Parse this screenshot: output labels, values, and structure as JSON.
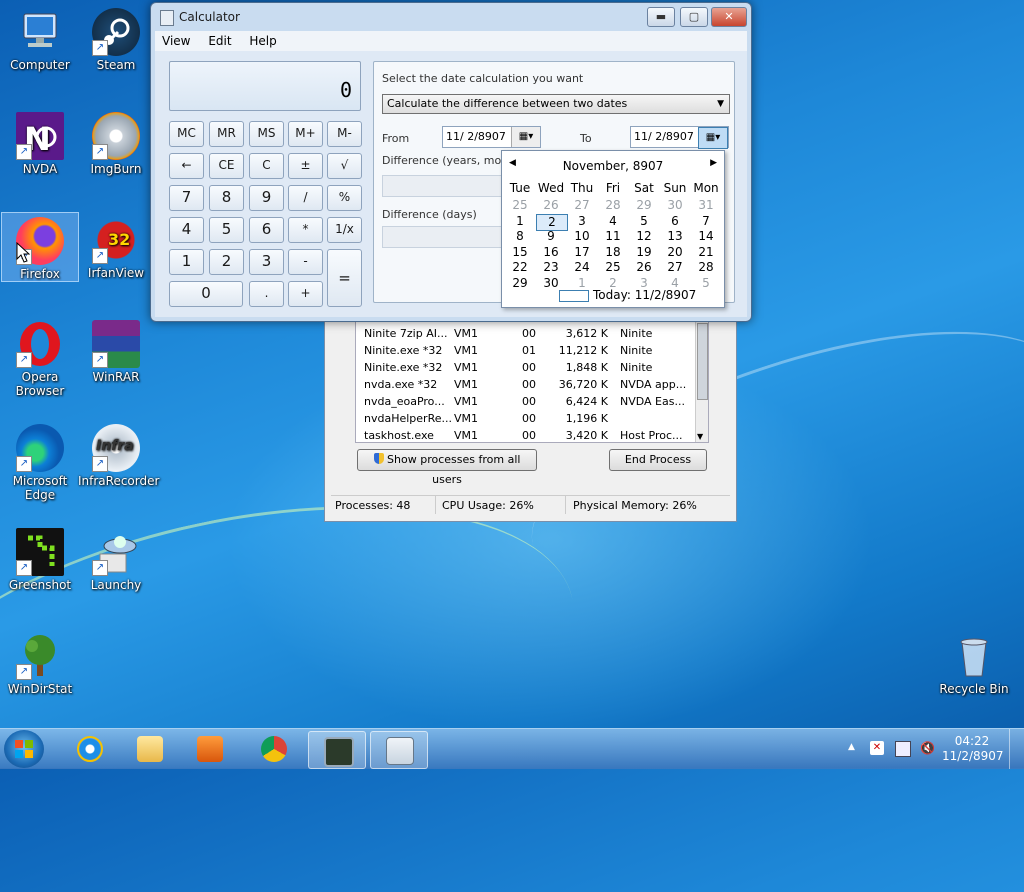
{
  "desktop": {
    "icons": [
      {
        "label": "Computer",
        "icon": "computer-icon"
      },
      {
        "label": "Steam",
        "icon": "steam-icon"
      },
      {
        "label": "NVDA",
        "icon": "nvda-icon"
      },
      {
        "label": "ImgBurn",
        "icon": "imgburn-icon"
      },
      {
        "label": "Firefox",
        "icon": "firefox-icon"
      },
      {
        "label": "IrfanView",
        "icon": "irfanview-icon"
      },
      {
        "label": "Opera Browser",
        "icon": "opera-icon"
      },
      {
        "label": "WinRAR",
        "icon": "winrar-icon"
      },
      {
        "label": "Microsoft Edge",
        "icon": "edge-icon"
      },
      {
        "label": "InfraRecorder",
        "icon": "infrarecorder-icon"
      },
      {
        "label": "Greenshot",
        "icon": "greenshot-icon"
      },
      {
        "label": "Launchy",
        "icon": "launchy-icon"
      },
      {
        "label": "WinDirStat",
        "icon": "windirstat-icon"
      },
      {
        "label": "Recycle Bin",
        "icon": "recycle-bin-icon"
      }
    ],
    "irfanview_badge": "32",
    "infrarecorder_overlay": "Infra"
  },
  "calculator": {
    "title": "Calculator",
    "menu": [
      "View",
      "Edit",
      "Help"
    ],
    "display": "0",
    "buttons": {
      "mem": [
        "MC",
        "MR",
        "MS",
        "M+",
        "M-"
      ],
      "row2": [
        "←",
        "CE",
        "C",
        "±",
        "√"
      ],
      "row3": [
        "7",
        "8",
        "9",
        "/",
        "%"
      ],
      "row4": [
        "4",
        "5",
        "6",
        "*",
        "1/x"
      ],
      "row5": [
        "1",
        "2",
        "3",
        "-"
      ],
      "row6": [
        "0",
        ".",
        "+"
      ],
      "equals": "="
    },
    "date_panel": {
      "prompt": "Select the date calculation you want",
      "mode": "Calculate the difference between two dates",
      "from_label": "From",
      "from_value": "11/  2/8907",
      "to_label": "To",
      "to_value": "11/  2/8907",
      "diff_ymwd_label": "Difference (years, month",
      "diff_days_label": "Difference (days)"
    },
    "calendar": {
      "month_label": "November, 8907",
      "dow": [
        "Tue",
        "Wed",
        "Thu",
        "Fri",
        "Sat",
        "Sun",
        "Mon"
      ],
      "weeks": [
        [
          "25",
          "26",
          "27",
          "28",
          "29",
          "30",
          "31"
        ],
        [
          "1",
          "2",
          "3",
          "4",
          "5",
          "6",
          "7"
        ],
        [
          "8",
          "9",
          "10",
          "11",
          "12",
          "13",
          "14"
        ],
        [
          "15",
          "16",
          "17",
          "18",
          "19",
          "20",
          "21"
        ],
        [
          "22",
          "23",
          "24",
          "25",
          "26",
          "27",
          "28"
        ],
        [
          "29",
          "30",
          "1",
          "2",
          "3",
          "4",
          "5"
        ]
      ],
      "selected": "2",
      "today_label": "Today: 11/2/8907"
    }
  },
  "task_manager": {
    "processes": [
      {
        "name": "Ninite 7zip AI...",
        "user": "VM1",
        "cpu": "00",
        "mem": "3,612 K",
        "desc": "Ninite"
      },
      {
        "name": "Ninite.exe *32",
        "user": "VM1",
        "cpu": "01",
        "mem": "11,212 K",
        "desc": "Ninite"
      },
      {
        "name": "Ninite.exe *32",
        "user": "VM1",
        "cpu": "00",
        "mem": "1,848 K",
        "desc": "Ninite"
      },
      {
        "name": "nvda.exe *32",
        "user": "VM1",
        "cpu": "00",
        "mem": "36,720 K",
        "desc": "NVDA app..."
      },
      {
        "name": "nvda_eoaPro...",
        "user": "VM1",
        "cpu": "00",
        "mem": "6,424 K",
        "desc": "NVDA Eas..."
      },
      {
        "name": "nvdaHelperRe...",
        "user": "VM1",
        "cpu": "00",
        "mem": "1,196 K",
        "desc": ""
      },
      {
        "name": "taskhost.exe",
        "user": "VM1",
        "cpu": "00",
        "mem": "3,420 K",
        "desc": "Host Proc..."
      }
    ],
    "show_all_label": "Show processes from all users",
    "end_process_label": "End Process",
    "status": {
      "processes": "Processes: 48",
      "cpu": "CPU Usage: 26%",
      "memory": "Physical Memory: 26%"
    }
  },
  "taskbar": {
    "time": "04:22",
    "date": "11/2/8907",
    "pinned": [
      "start-button",
      "internet-explorer",
      "file-explorer",
      "media-player",
      "chrome",
      "task-manager",
      "calculator"
    ]
  }
}
